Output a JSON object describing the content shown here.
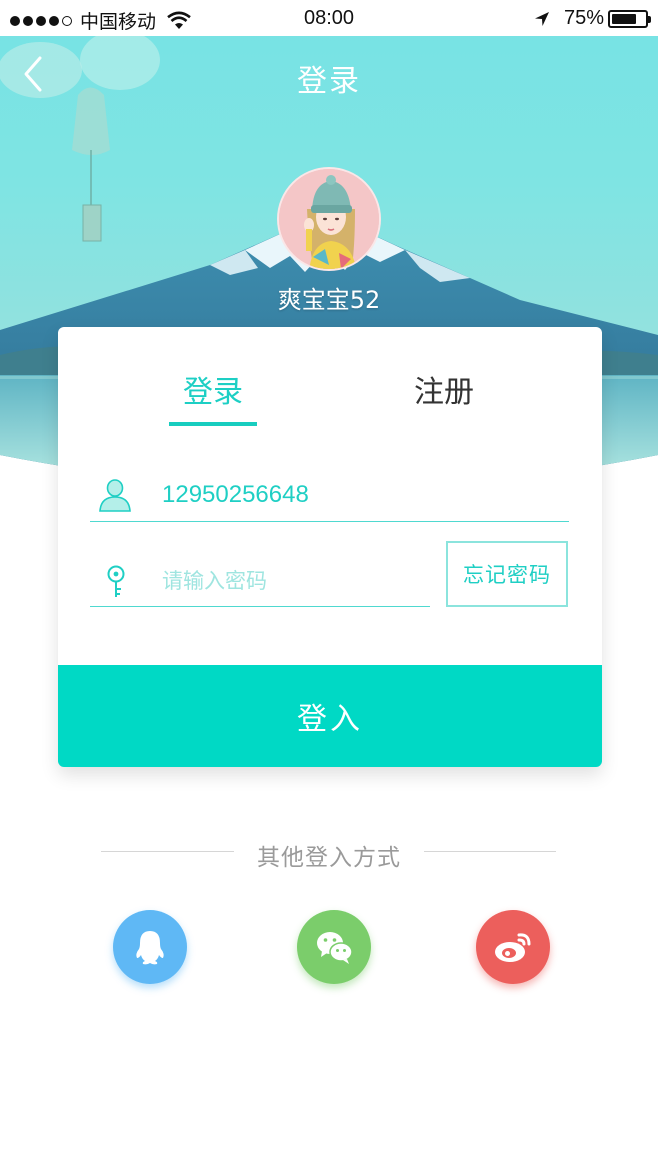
{
  "status_bar": {
    "carrier": "中国移动",
    "time": "08:00",
    "battery_percent": "75%",
    "battery_level": 0.75
  },
  "nav": {
    "title": "登录",
    "back_icon": "chevron-left-icon"
  },
  "profile": {
    "username": "爽宝宝52"
  },
  "tabs": {
    "login": "登录",
    "register": "注册",
    "active": "login"
  },
  "form": {
    "phone_value": "12950256648",
    "password_placeholder": "请输入密码",
    "forgot_label": "忘记密码",
    "submit_label": "登入"
  },
  "other_login": {
    "label": "其他登入方式",
    "providers": [
      "qq-icon",
      "wechat-icon",
      "weibo-icon"
    ]
  },
  "colors": {
    "accent": "#00d9c5",
    "qq": "#5fb8f5",
    "wechat": "#7bcd6b",
    "weibo": "#ec5f5c"
  }
}
